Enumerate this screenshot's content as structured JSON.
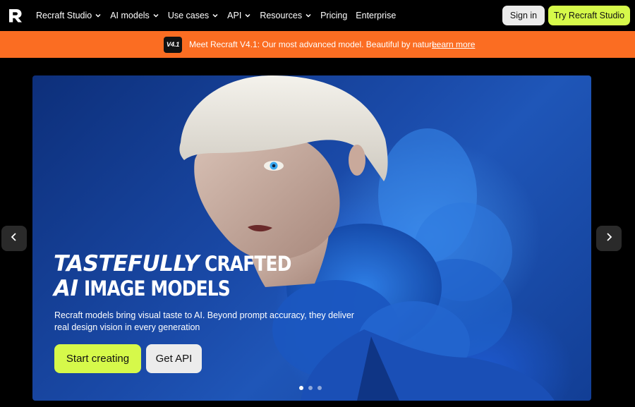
{
  "nav": {
    "logo_icon": "recraft-logo-icon",
    "menu": [
      {
        "label": "Recraft Studio",
        "has_dropdown": true
      },
      {
        "label": "AI models",
        "has_dropdown": true
      },
      {
        "label": "Use cases",
        "has_dropdown": true
      },
      {
        "label": "API",
        "has_dropdown": true
      },
      {
        "label": "Resources",
        "has_dropdown": true
      },
      {
        "label": "Pricing",
        "has_dropdown": false
      },
      {
        "label": "Enterprise",
        "has_dropdown": false
      }
    ],
    "signin_label": "Sign in",
    "try_label": "Try Recraft Studio"
  },
  "announcement": {
    "badge": "V4.1",
    "text": "Meet Recraft V4.1: Our most advanced model. Beautiful by nature.",
    "link": "Learn more",
    "background": "#fb6d22"
  },
  "hero": {
    "headline_line1_italic": "TASTEFULLY",
    "headline_line1_regular": "CRAFTED",
    "headline_line2_italic": "AI",
    "headline_line2_regular": "IMAGE MODELS",
    "subtext": "Recraft models bring visual taste to AI. Beyond prompt accuracy, they deliver real design vision in every generation",
    "primary_button": "Start creating",
    "secondary_button": "Get API",
    "carousel_total": 3,
    "carousel_active": 1
  },
  "colors": {
    "accent_lime": "#d6f94a",
    "orange": "#fb6d22",
    "background": "#000000"
  }
}
